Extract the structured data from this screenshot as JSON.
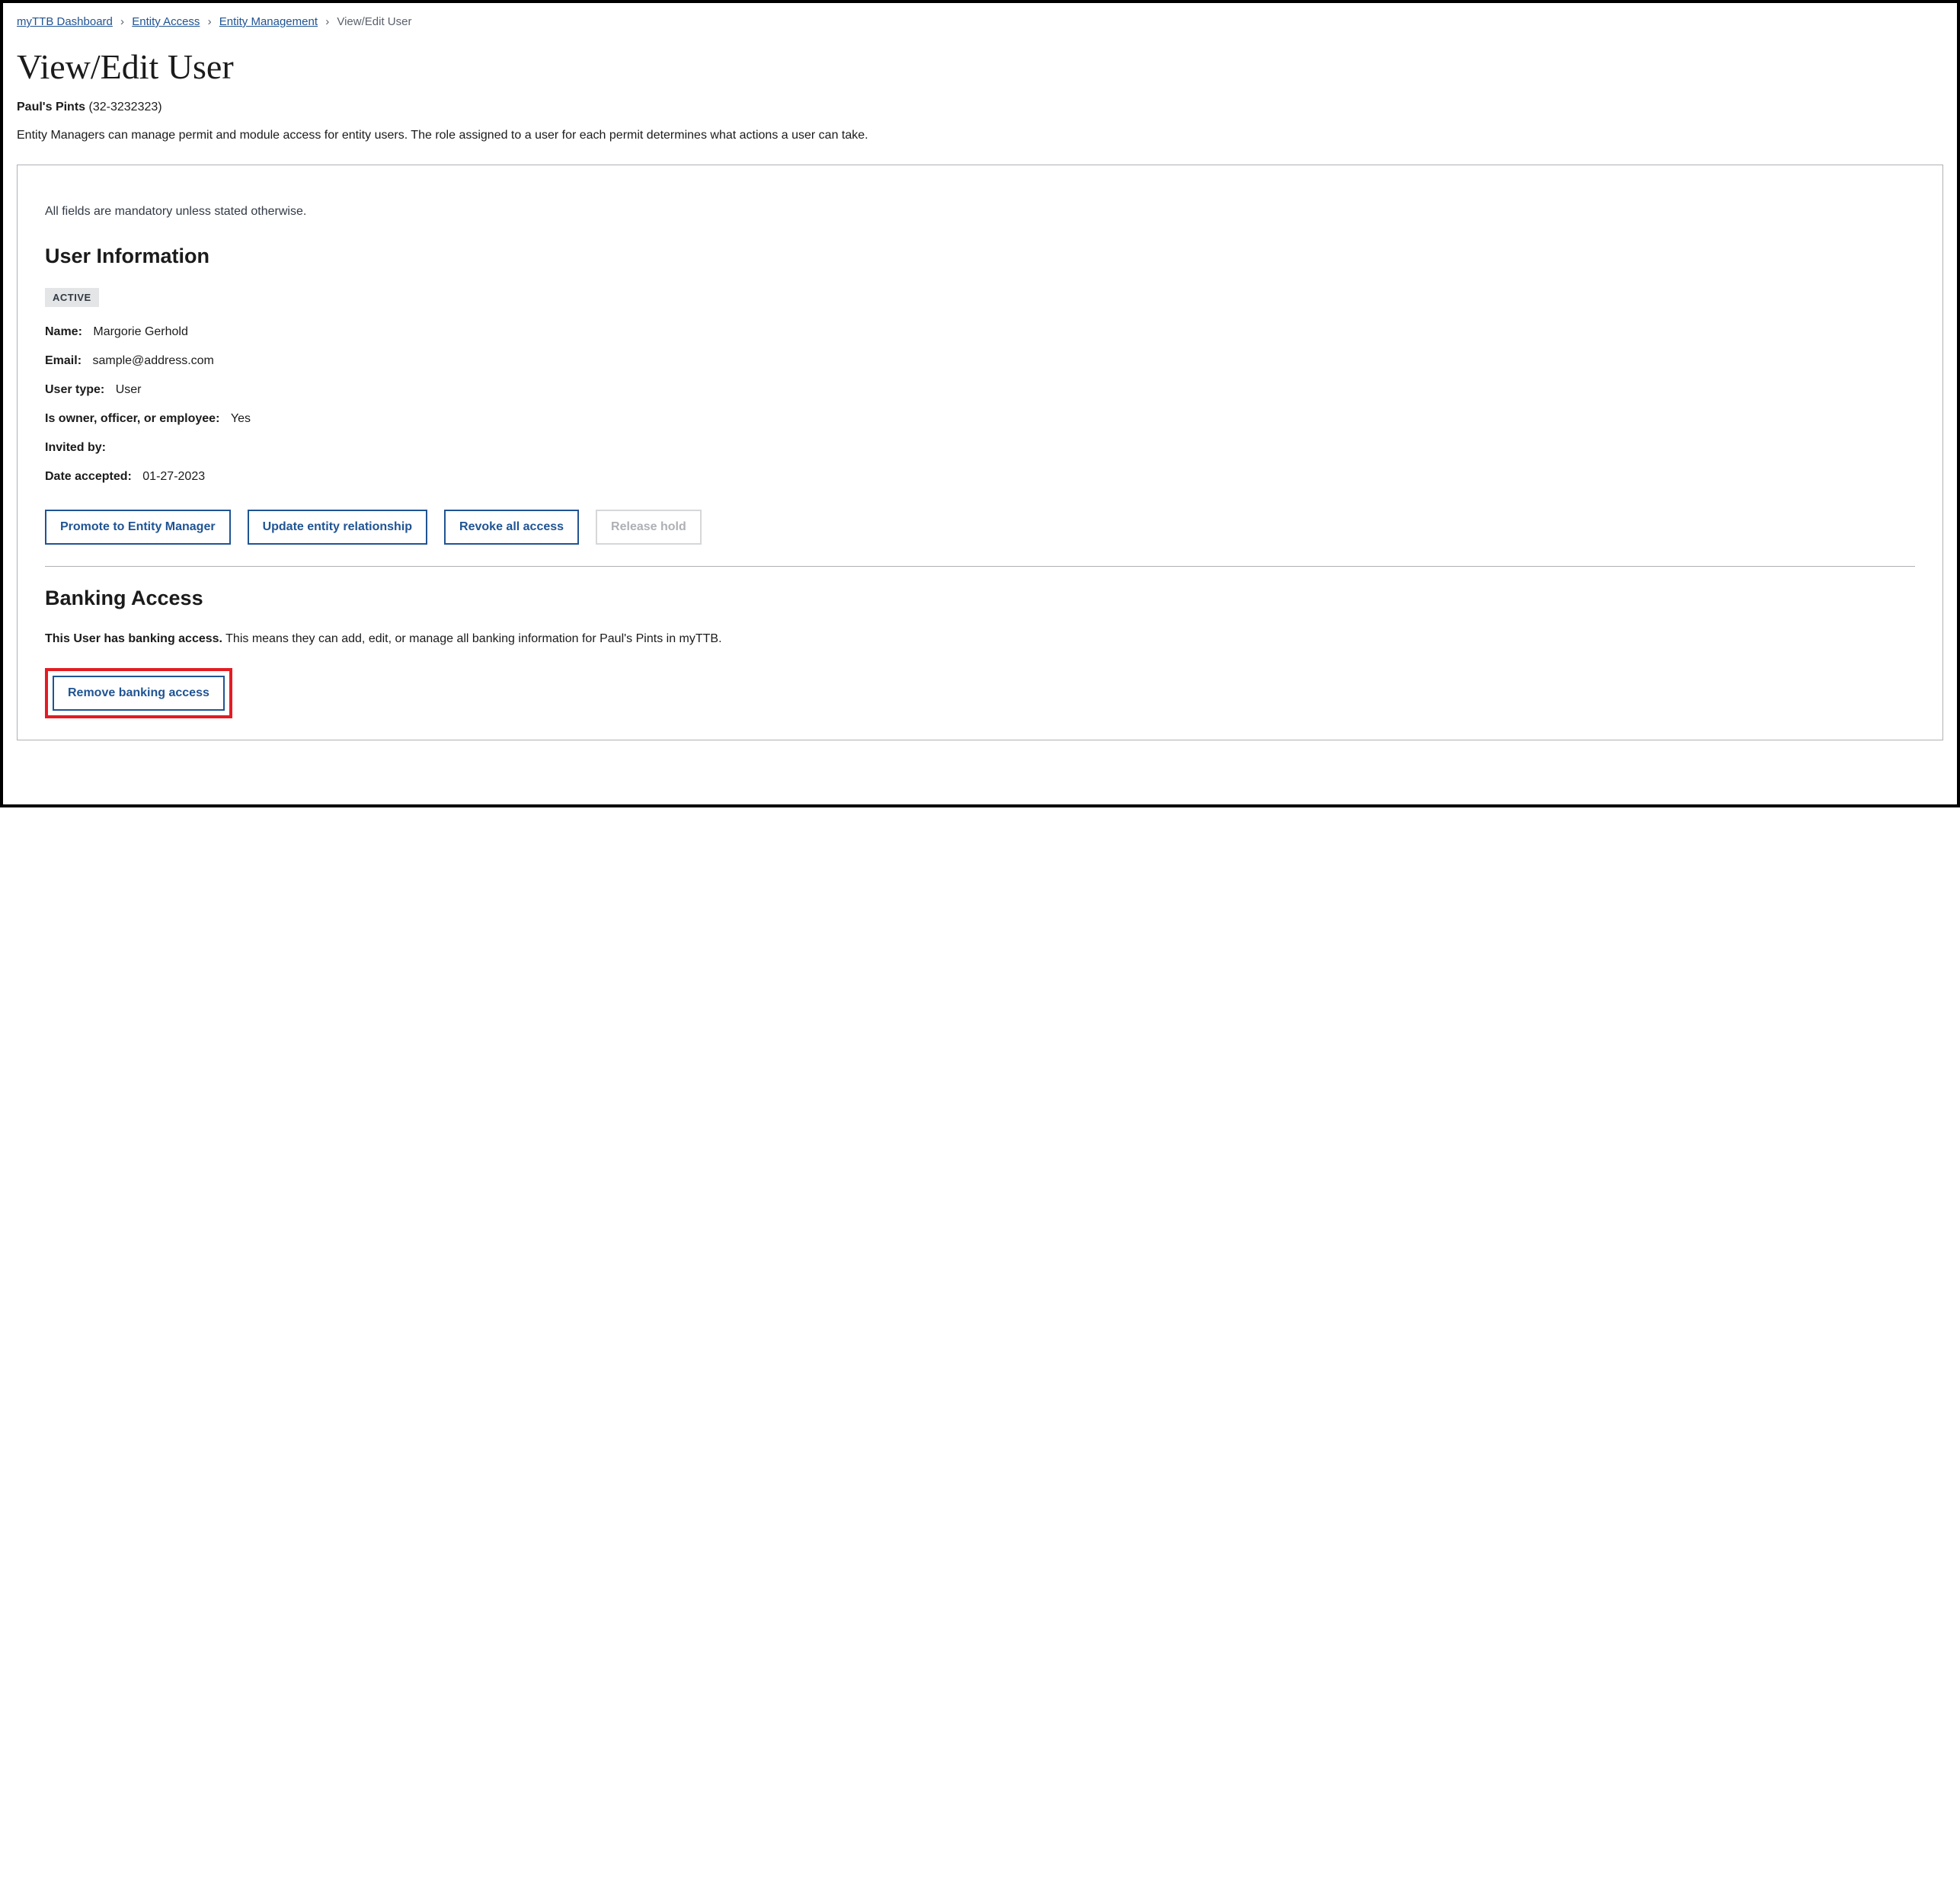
{
  "breadcrumb": {
    "items": [
      {
        "label": "myTTB Dashboard",
        "link": true
      },
      {
        "label": "Entity Access",
        "link": true
      },
      {
        "label": "Entity Management",
        "link": true
      },
      {
        "label": "View/Edit User",
        "link": false
      }
    ]
  },
  "page_title": "View/Edit User",
  "entity": {
    "name": "Paul's Pints",
    "id": "(32-3232323)"
  },
  "intro_text": "Entity Managers can manage permit and module access for entity users. The role assigned to a user for each permit determines what actions a user can take.",
  "card": {
    "mandatory_note": "All fields are mandatory unless stated otherwise.",
    "user_info": {
      "heading": "User Information",
      "status": "ACTIVE",
      "fields": {
        "name_label": "Name:",
        "name_value": "Margorie Gerhold",
        "email_label": "Email:",
        "email_value": "sample@address.com",
        "user_type_label": "User type:",
        "user_type_value": "User",
        "owner_label": "Is owner, officer, or employee:",
        "owner_value": "Yes",
        "invited_by_label": "Invited by:",
        "invited_by_value": "",
        "date_accepted_label": "Date accepted:",
        "date_accepted_value": "01-27-2023"
      },
      "buttons": {
        "promote": "Promote to Entity Manager",
        "update_relationship": "Update entity relationship",
        "revoke": "Revoke all access",
        "release_hold": "Release hold"
      }
    },
    "banking": {
      "heading": "Banking Access",
      "bold_text": "This User has banking access.",
      "rest_text": " This means they can add, edit, or manage all banking information for Paul's Pints in myTTB.",
      "remove_button": "Remove banking access"
    }
  }
}
